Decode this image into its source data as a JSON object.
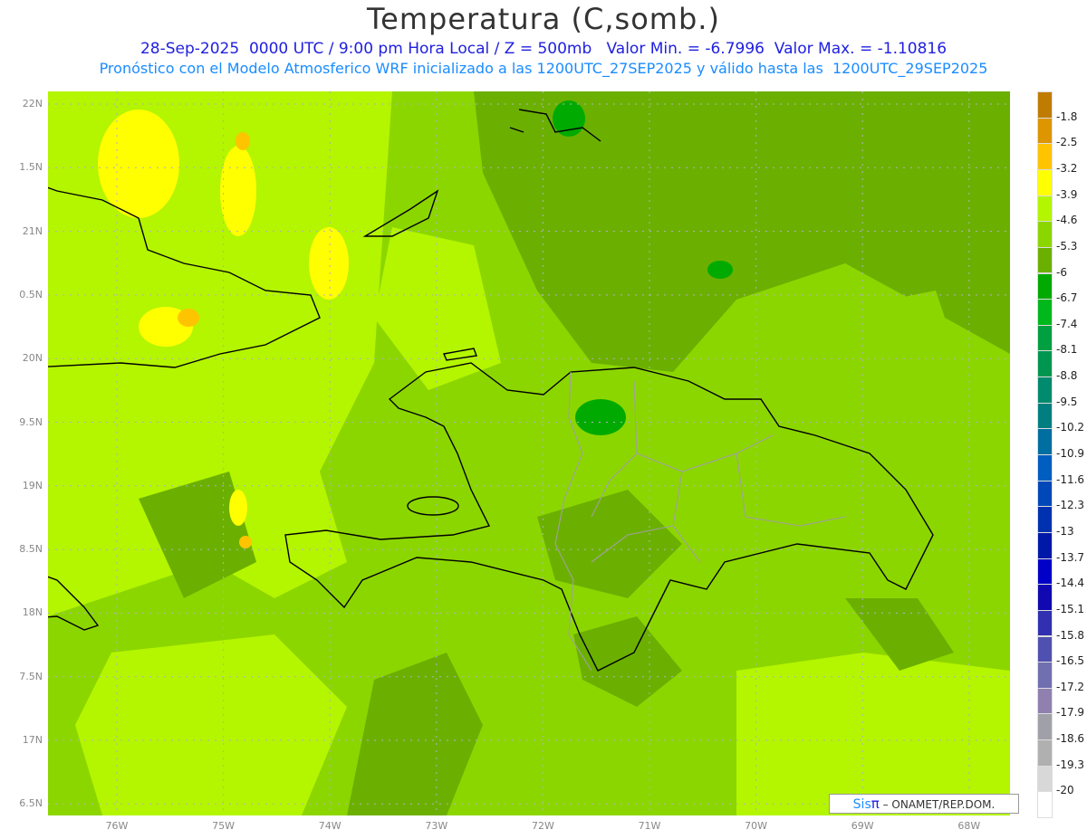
{
  "header": {
    "title": "Temperatura (C,somb.)",
    "line1": "28-Sep-2025  0000 UTC / 9:00 pm Hora Local / Z = 500mb   Valor Min. = -6.7996  Valor Max. = -1.10816",
    "line2": "Pronóstico con el Modelo Atmosferico WRF inicializado a las 1200UTC_27SEP2025 y válido hasta las  1200UTC_29SEP2025"
  },
  "axes": {
    "lat_labels": [
      "22N",
      "1.5N",
      "21N",
      "0.5N",
      "20N",
      "9.5N",
      "19N",
      "8.5N",
      "18N",
      "7.5N",
      "17N",
      "6.5N"
    ],
    "lon_labels": [
      "76W",
      "75W",
      "74W",
      "73W",
      "72W",
      "71W",
      "70W",
      "69W",
      "68W"
    ]
  },
  "colorbar": {
    "labels": [
      "-1.8",
      "-2.5",
      "-3.2",
      "-3.9",
      "-4.6",
      "-5.3",
      "-6",
      "-6.7",
      "-7.4",
      "-8.1",
      "-8.8",
      "-9.5",
      "-10.2",
      "-10.9",
      "-11.6",
      "-12.3",
      "-13",
      "-13.7",
      "-14.4",
      "-15.1",
      "-15.8",
      "-16.5",
      "-17.2",
      "-17.9",
      "-18.6",
      "-19.3",
      "-20"
    ],
    "colors": [
      "#c07c00",
      "#dd9500",
      "#ffc400",
      "#ffff00",
      "#b4f500",
      "#8cd600",
      "#6bb000",
      "#00aa00",
      "#00b81c",
      "#00a040",
      "#009650",
      "#008a6e",
      "#007e80",
      "#006ea0",
      "#005ec0",
      "#0048b8",
      "#0032b0",
      "#0018a8",
      "#0000c8",
      "#1008b0",
      "#3030b0",
      "#5050b0",
      "#7070b0",
      "#9080b0",
      "#a0a0a8",
      "#b0b0b0",
      "#d8d8d8",
      "#ffffff"
    ]
  },
  "credit": {
    "brand_a": "Sis",
    "brand_b": "π",
    "text": " – ONAMET/REP.DOM."
  }
}
